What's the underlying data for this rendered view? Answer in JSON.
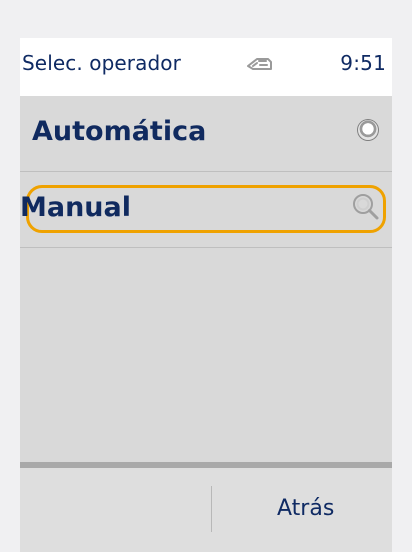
{
  "statusbar": {
    "title": "Selec. operador",
    "time": "9:51",
    "icon": "sim-card-icon"
  },
  "list": {
    "items": [
      {
        "label": "Automática",
        "icon": "radio-button-icon",
        "selected": false
      },
      {
        "label": "Manual",
        "icon": "search-icon",
        "selected": true
      }
    ]
  },
  "softkeys": {
    "right_label": "Atrás"
  },
  "colors": {
    "background": "#f0f0f2",
    "surface": "#d9d9d9",
    "text": "#102a5f",
    "accent_focus": "#efa200"
  }
}
